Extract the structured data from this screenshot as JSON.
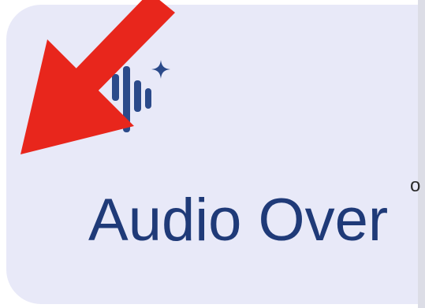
{
  "card": {
    "label": "Audio Over",
    "icon": "audio-waveform-sparkle-icon"
  },
  "neighbor": {
    "fragment": "o"
  },
  "annotation": {
    "shape": "arrow",
    "color": "#e8261c"
  },
  "colors": {
    "card_background": "#e8e9f8",
    "label_text": "#1f3a78",
    "icon": "#2b4a8a"
  }
}
